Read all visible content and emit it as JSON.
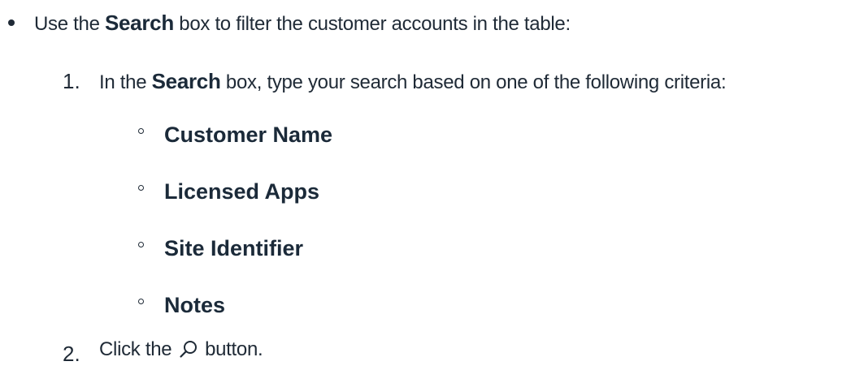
{
  "intro": {
    "prefix": "Use the ",
    "bold": "Search",
    "suffix": " box to filter the customer accounts in the table:"
  },
  "steps": [
    {
      "number": "1.",
      "prefix": "In the ",
      "bold": "Search",
      "suffix": " box, type your search based on one of the following criteria:"
    },
    {
      "number": "2.",
      "prefix": "Click the ",
      "icon": "search-icon",
      "suffix": " button."
    }
  ],
  "criteria": [
    "Customer Name",
    "Licensed Apps",
    "Site Identifier",
    "Notes"
  ]
}
